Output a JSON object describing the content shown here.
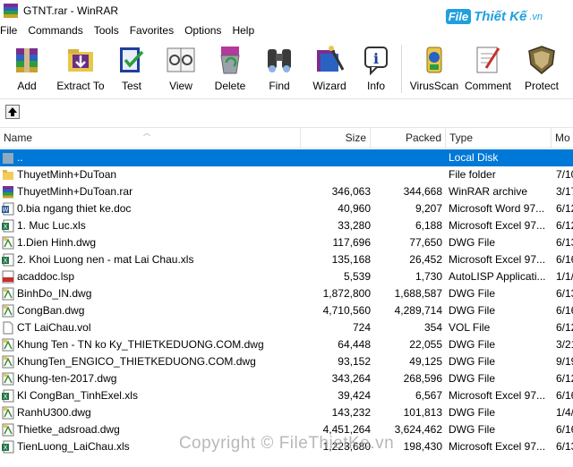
{
  "window": {
    "title": "GTNT.rar - WinRAR"
  },
  "watermark": {
    "brand_box": "File",
    "brand_rest": "Thiết Kế",
    "brand_tld": ".vn",
    "copyright": "Copyright © FileThietKe.vn"
  },
  "menu": [
    "File",
    "Commands",
    "Tools",
    "Favorites",
    "Options",
    "Help"
  ],
  "toolbar": [
    {
      "label": "Add",
      "icon": "add-books-icon"
    },
    {
      "label": "Extract To",
      "icon": "extract-folder-icon"
    },
    {
      "label": "Test",
      "icon": "test-check-icon"
    },
    {
      "label": "View",
      "icon": "view-glasses-icon"
    },
    {
      "label": "Delete",
      "icon": "delete-recycle-icon"
    },
    {
      "label": "Find",
      "icon": "find-binoculars-icon"
    },
    {
      "label": "Wizard",
      "icon": "wizard-icon"
    },
    {
      "label": "Info",
      "icon": "info-icon"
    },
    {
      "label": "VirusScan",
      "icon": "virus-scan-icon"
    },
    {
      "label": "Comment",
      "icon": "comment-pen-icon"
    },
    {
      "label": "Protect",
      "icon": "protect-shield-icon"
    }
  ],
  "columns": {
    "name": "Name",
    "size": "Size",
    "packed": "Packed",
    "type": "Type",
    "modified": "Mo"
  },
  "files": [
    {
      "name": "..",
      "size": "",
      "packed": "",
      "type": "Local Disk",
      "modified": "",
      "icon": "parent-folder-icon",
      "selected": true
    },
    {
      "name": "ThuyetMinh+DuToan",
      "size": "",
      "packed": "",
      "type": "File folder",
      "modified": "7/10",
      "icon": "folder-icon"
    },
    {
      "name": "ThuyetMinh+DuToan.rar",
      "size": "346,063",
      "packed": "344,668",
      "type": "WinRAR archive",
      "modified": "3/17",
      "icon": "rar-archive-icon"
    },
    {
      "name": "0.bia ngang thiet ke.doc",
      "size": "40,960",
      "packed": "9,207",
      "type": "Microsoft Word 97...",
      "modified": "6/12",
      "icon": "word-doc-icon"
    },
    {
      "name": "1. Muc Luc.xls",
      "size": "33,280",
      "packed": "6,188",
      "type": "Microsoft Excel 97...",
      "modified": "6/12",
      "icon": "excel-icon"
    },
    {
      "name": "1.Dien Hinh.dwg",
      "size": "117,696",
      "packed": "77,650",
      "type": "DWG File",
      "modified": "6/13",
      "icon": "dwg-icon"
    },
    {
      "name": "2. Khoi Luong nen - mat Lai Chau.xls",
      "size": "135,168",
      "packed": "26,452",
      "type": "Microsoft Excel 97...",
      "modified": "6/16",
      "icon": "excel-icon"
    },
    {
      "name": "acaddoc.lsp",
      "size": "5,539",
      "packed": "1,730",
      "type": "AutoLISP Applicati...",
      "modified": "1/1/",
      "icon": "lsp-icon"
    },
    {
      "name": "BinhDo_IN.dwg",
      "size": "1,872,800",
      "packed": "1,688,587",
      "type": "DWG File",
      "modified": "6/13",
      "icon": "dwg-icon"
    },
    {
      "name": "CongBan.dwg",
      "size": "4,710,560",
      "packed": "4,289,714",
      "type": "DWG File",
      "modified": "6/16",
      "icon": "dwg-icon"
    },
    {
      "name": "CT LaiChau.vol",
      "size": "724",
      "packed": "354",
      "type": "VOL File",
      "modified": "6/12",
      "icon": "blank-file-icon"
    },
    {
      "name": "Khung Ten - TN ko Ky_THIETKEDUONG.COM.dwg",
      "size": "64,448",
      "packed": "22,055",
      "type": "DWG File",
      "modified": "3/21",
      "icon": "dwg-icon"
    },
    {
      "name": "KhungTen_ENGICO_THIETKEDUONG.COM.dwg",
      "size": "93,152",
      "packed": "49,125",
      "type": "DWG File",
      "modified": "9/19",
      "icon": "dwg-icon"
    },
    {
      "name": "Khung-ten-2017.dwg",
      "size": "343,264",
      "packed": "268,596",
      "type": "DWG File",
      "modified": "6/12",
      "icon": "dwg-icon"
    },
    {
      "name": "Kl CongBan_TinhExel.xls",
      "size": "39,424",
      "packed": "6,567",
      "type": "Microsoft Excel 97...",
      "modified": "6/16",
      "icon": "excel-icon"
    },
    {
      "name": "RanhU300.dwg",
      "size": "143,232",
      "packed": "101,813",
      "type": "DWG File",
      "modified": "1/4/",
      "icon": "dwg-icon"
    },
    {
      "name": "Thietke_adsroad.dwg",
      "size": "4,451,264",
      "packed": "3,624,462",
      "type": "DWG File",
      "modified": "6/16",
      "icon": "dwg-icon"
    },
    {
      "name": "TienLuong_LaiChau.xls",
      "size": "1,223,680",
      "packed": "198,430",
      "type": "Microsoft Excel 97...",
      "modified": "6/13",
      "icon": "excel-icon"
    }
  ],
  "colors": {
    "selection": "#0078d7",
    "brand": "#1fa0df"
  }
}
